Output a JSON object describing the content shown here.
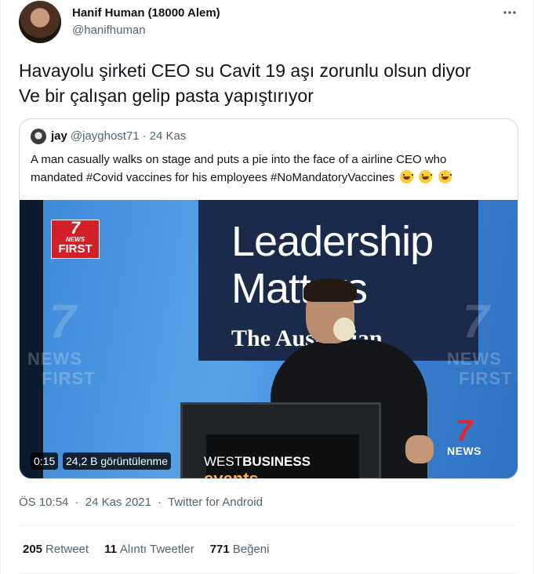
{
  "author": {
    "name": "Hanif Human (18000 Alem)",
    "handle": "@hanifhuman"
  },
  "more_icon": "more-horizontal-icon",
  "tweet": {
    "line1": "Havayolu şirketi CEO su Cavit 19 aşı zorunlu olsun diyor",
    "line2": "Ve bir çalışan gelip pasta yapıştırıyor"
  },
  "quote": {
    "name": "jay",
    "handle": "@jayghost71",
    "dot": "·",
    "date": "24 Kas",
    "text_line1": "A man casually walks on stage and puts a pie into the face of a airline CEO who",
    "text_line2": "mandated #Covid vaccines for his employees #NoMandatoryVaccines",
    "emoji": "grinning-squinting-face"
  },
  "video": {
    "duration": "0:15",
    "views": "24,2 B görüntülenme",
    "overlay": {
      "news_first_7": "7",
      "news_first_news": "NEWS",
      "news_first_first": "FIRST",
      "banner_line1": "Leadership",
      "banner_line2": "Matters",
      "banner_line3": "The Australian",
      "podium_prefix": "WEST",
      "podium_bold": "BUSINESS",
      "podium_line2": "events",
      "watermark_7": "7",
      "watermark_news": "NEWS",
      "watermark_first": "FIRST",
      "seven_news_7": "7",
      "seven_news_label": "NEWS"
    }
  },
  "meta": {
    "time": "ÖS 10:54",
    "dot1": "·",
    "date": "24 Kas 2021",
    "dot2": "·",
    "source": "Twitter for Android"
  },
  "stats": {
    "retweets_count": "205",
    "retweets_label": "Retweet",
    "quotes_count": "11",
    "quotes_label": "Alıntı Tweetler",
    "likes_count": "771",
    "likes_label": "Beğeni"
  }
}
